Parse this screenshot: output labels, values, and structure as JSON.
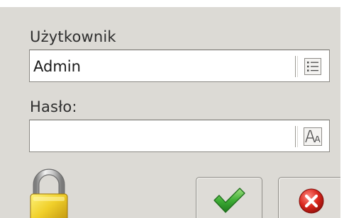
{
  "login": {
    "user_label": "Użytkownik",
    "user_value": "Admin",
    "password_label": "Hasło:",
    "password_value": ""
  },
  "icons": {
    "user_list": "list-icon",
    "keyboard": "keyboard-icon",
    "lock": "padlock-icon",
    "confirm": "checkmark-icon",
    "cancel": "cancel-icon"
  },
  "colors": {
    "background": "#dcdad5",
    "confirm_green": "#3fae36",
    "cancel_red": "#d9261c",
    "lock_gold": "#f0cf2a"
  }
}
